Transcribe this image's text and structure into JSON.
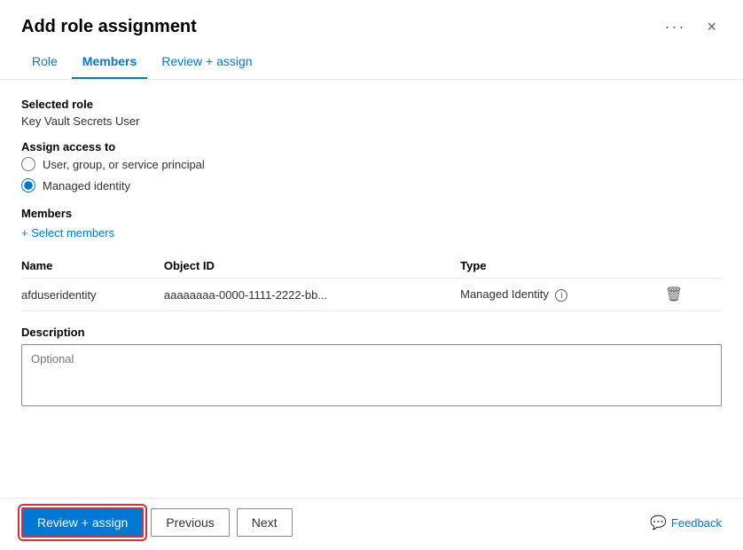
{
  "dialog": {
    "title": "Add role assignment",
    "ellipsis": "···",
    "close_label": "×"
  },
  "tabs": [
    {
      "id": "role",
      "label": "Role",
      "active": false
    },
    {
      "id": "members",
      "label": "Members",
      "active": true
    },
    {
      "id": "review",
      "label": "Review + assign",
      "active": false
    }
  ],
  "content": {
    "selected_role_label": "Selected role",
    "selected_role_value": "Key Vault Secrets User",
    "assign_access_label": "Assign access to",
    "radio_options": [
      {
        "id": "user",
        "label": "User, group, or service principal",
        "checked": false
      },
      {
        "id": "managed",
        "label": "Managed identity",
        "checked": true
      }
    ],
    "members_label": "Members",
    "select_members_label": "+ Select members",
    "table": {
      "headers": [
        "Name",
        "Object ID",
        "Type",
        ""
      ],
      "rows": [
        {
          "name": "afduseridentity",
          "object_id": "aaaaaaaa-0000-1111-2222-bb...",
          "type": "Managed Identity",
          "has_info": true
        }
      ]
    },
    "description_label": "Description",
    "description_placeholder": "Optional"
  },
  "footer": {
    "review_assign_label": "Review + assign",
    "previous_label": "Previous",
    "next_label": "Next",
    "feedback_label": "Feedback"
  }
}
